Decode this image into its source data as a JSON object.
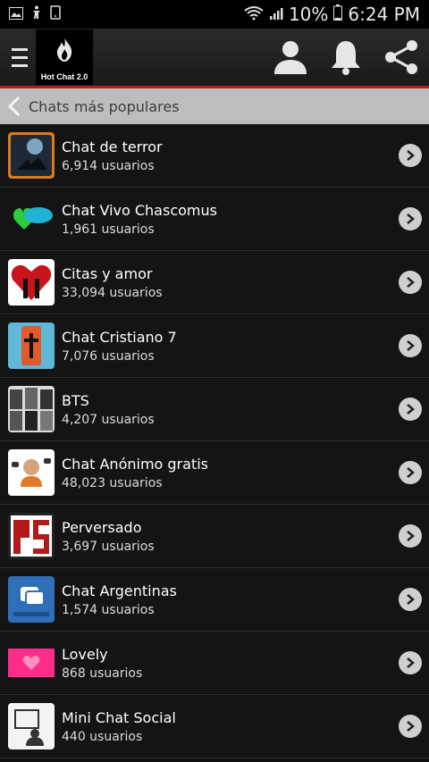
{
  "status_bar": {
    "battery": "10%",
    "time": "6:24 PM"
  },
  "app_bar": {
    "logo_text": "Hot Chat 2.0"
  },
  "subheader": {
    "title": "Chats más populares"
  },
  "chats": [
    {
      "name": "Chat de terror",
      "users": "6,914 usuarios",
      "thumb_color": "#1d2a35"
    },
    {
      "name": "Chat Vivo Chascomus",
      "users": "1,961 usuarios",
      "thumb_color": "#1fb3d6"
    },
    {
      "name": "Citas y amor",
      "users": "33,094 usuarios",
      "thumb_color": "#c8151c"
    },
    {
      "name": "Chat Cristiano 7",
      "users": "7,076 usuarios",
      "thumb_color": "#e05a2a"
    },
    {
      "name": "BTS",
      "users": "4,207 usuarios",
      "thumb_color": "#777777"
    },
    {
      "name": "Chat Anónimo gratis",
      "users": "48,023 usuarios",
      "thumb_color": "#ffffff"
    },
    {
      "name": "Perversado",
      "users": "3,697 usuarios",
      "thumb_color": "#b01a1a"
    },
    {
      "name": "Chat Argentinas",
      "users": "1,574 usuarios",
      "thumb_color": "#2f6fb8"
    },
    {
      "name": "Lovely",
      "users": "868 usuarios",
      "thumb_color": "#ff2d8a"
    },
    {
      "name": "Mini Chat Social",
      "users": "440 usuarios",
      "thumb_color": "#f3f3f3"
    }
  ]
}
